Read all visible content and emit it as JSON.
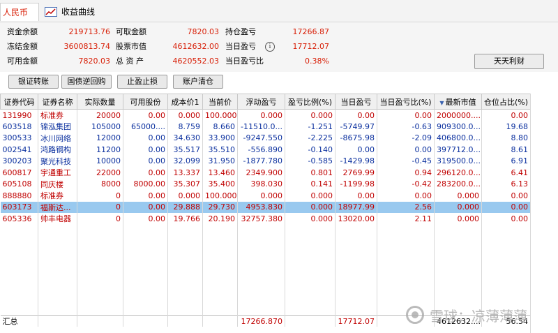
{
  "tabs": {
    "rmb": "人民币",
    "curve": "收益曲线"
  },
  "summary": {
    "zijin_yue_label": "资金余额",
    "zijin_yue": "219713.76",
    "dongjie_label": "冻结金额",
    "dongjie": "3600813.74",
    "keyong_label": "可用金额",
    "keyong": "7820.03",
    "kequ_label": "可取金额",
    "kequ": "7820.03",
    "gupiao_shizhi_label": "股票市值",
    "gupiao_shizhi": "4612632.00",
    "zongzichan_label": "总 资 产",
    "zongzichan": "4620552.03",
    "chicang_yingkui_label": "持仓盈亏",
    "chicang_yingkui": "17266.87",
    "dangri_yingkui_label": "当日盈亏",
    "dangri_yingkui": "17712.07",
    "dangri_ykb_label": "当日盈亏比",
    "dangri_ykb": "0.38%"
  },
  "buttons": {
    "yinzheng": "银证转账",
    "guozhai": "国债逆回购",
    "zhiying": "止盈止损",
    "qingcang": "账户清仓",
    "tiantian": "天天利财"
  },
  "table": {
    "headers": [
      "证券代码",
      "证券名称",
      "实际数量",
      "可用股份",
      "成本价1",
      "当前价",
      "浮动盈亏",
      "盈亏比例(%)",
      "当日盈亏",
      "当日盈亏比(%)",
      "最新市值",
      "仓位占比(%)"
    ],
    "rows": [
      {
        "color": "red",
        "cells": [
          "131990",
          "标准券",
          "20000",
          "0.00",
          "0.000",
          "100.000",
          "0.000",
          "0.000",
          "0.00",
          "0.00",
          "2000000....",
          "0.00"
        ]
      },
      {
        "color": "blue",
        "cells": [
          "603518",
          "锦泓集团",
          "105000",
          "65000....",
          "8.759",
          "8.660",
          "-11510.0...",
          "-1.251",
          "-5749.97",
          "-0.63",
          "909300.0...",
          "19.68"
        ]
      },
      {
        "color": "blue",
        "cells": [
          "300533",
          "冰川网络",
          "12000",
          "0.00",
          "34.630",
          "33.900",
          "-9247.550",
          "-2.225",
          "-8675.98",
          "-2.09",
          "406800.0...",
          "8.80"
        ]
      },
      {
        "color": "blue",
        "cells": [
          "002541",
          "鸿路钢构",
          "11200",
          "0.00",
          "35.517",
          "35.510",
          "-556.890",
          "-0.140",
          "0.00",
          "0.00",
          "397712.0...",
          "8.61"
        ]
      },
      {
        "color": "blue",
        "cells": [
          "300203",
          "聚光科技",
          "10000",
          "0.00",
          "32.099",
          "31.950",
          "-1877.780",
          "-0.585",
          "-1429.98",
          "-0.45",
          "319500.0...",
          "6.91"
        ]
      },
      {
        "color": "red",
        "cells": [
          "600817",
          "宇通重工",
          "22000",
          "0.00",
          "13.337",
          "13.460",
          "2349.900",
          "0.801",
          "2769.99",
          "0.94",
          "296120.0...",
          "6.41"
        ]
      },
      {
        "color": "red",
        "cells": [
          "605108",
          "同庆楼",
          "8000",
          "8000.00",
          "35.307",
          "35.400",
          "398.030",
          "0.141",
          "-1199.98",
          "-0.42",
          "283200.0...",
          "6.13"
        ]
      },
      {
        "color": "red",
        "cells": [
          "888880",
          "标准券",
          "0",
          "0.00",
          "0.000",
          "100.000",
          "0.000",
          "0.000",
          "0.00",
          "0.00",
          "0.000",
          "0.00"
        ]
      },
      {
        "color": "red",
        "selected": true,
        "cells": [
          "603173",
          "福斯达...",
          "0",
          "0.00",
          "29.888",
          "29.730",
          "4953.830",
          "0.000",
          "18977.99",
          "2.56",
          "0.000",
          "0.00"
        ]
      },
      {
        "color": "red",
        "cells": [
          "605336",
          "帅丰电器",
          "0",
          "0.00",
          "19.766",
          "20.190",
          "32757.380",
          "0.000",
          "13020.00",
          "2.11",
          "0.000",
          "0.00"
        ]
      }
    ],
    "total": {
      "label": "汇总",
      "fudong": "17266.870",
      "dangri": "17712.07",
      "shizhi": "4612632....",
      "cangwei": "56.54"
    }
  },
  "watermark": {
    "text": "雪球：凉薄薄薄"
  },
  "colors": {
    "accent_red": "#d81e06",
    "blue_text": "#0a2f9e",
    "selected_row": "#99c9ef"
  }
}
